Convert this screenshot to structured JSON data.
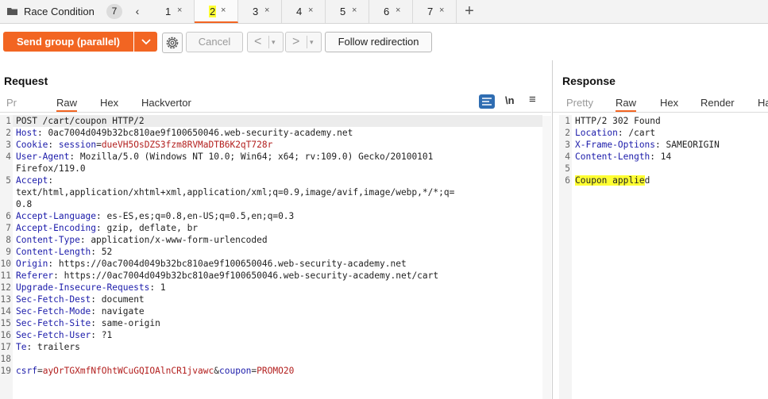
{
  "tab_bar": {
    "group_name": "Race Condition",
    "group_count": "7",
    "collapse_icon": "chevron-left-icon",
    "tabs": [
      {
        "label": "1",
        "close": "×"
      },
      {
        "label": "2",
        "close": "×"
      },
      {
        "label": "3",
        "close": "×"
      },
      {
        "label": "4",
        "close": "×"
      },
      {
        "label": "5",
        "close": "×"
      },
      {
        "label": "6",
        "close": "×"
      },
      {
        "label": "7",
        "close": "×"
      }
    ],
    "active_tab": "2",
    "add_tab_icon": "plus-icon"
  },
  "toolbar": {
    "send_label": "Send group (parallel)",
    "send_dropdown_glyph": "⌄",
    "settings_icon": "gear-icon",
    "cancel_label": "Cancel",
    "prev_glyph": "<",
    "next_glyph": ">",
    "nav_dropdown_glyph": "▾",
    "follow_label": "Follow redirection"
  },
  "request": {
    "title": "Request",
    "tabs": [
      "Pr",
      "Raw",
      "Hex",
      "Hackvertor"
    ],
    "active_tab": "Raw",
    "newline_label": "\\n",
    "menu_glyph": "≡",
    "lines": [
      {
        "n": "1",
        "text": "POST /cart/coupon HTTP/2"
      },
      {
        "n": "2",
        "key": "Host",
        "value": "0ac7004d049b32bc810ae9f100650046.web-security-academy.net"
      },
      {
        "n": "3",
        "key": "Cookie",
        "cookie_name": "session",
        "cookie_value": "dueVH5OsDZS3fzm8RVMaDTB6K2qT728r"
      },
      {
        "n": "4",
        "key": "User-Agent",
        "value": "Mozilla/5.0 (Windows NT 10.0; Win64; x64; rv:109.0) Gecko/20100101",
        "cont": "Firefox/119.0"
      },
      {
        "n": "5",
        "key": "Accept",
        "value": "",
        "cont": "text/html,application/xhtml+xml,application/xml;q=0.9,image/avif,image/webp,*/*;q=",
        "cont2": "0.8"
      },
      {
        "n": "6",
        "key": "Accept-Language",
        "value": "es-ES,es;q=0.8,en-US;q=0.5,en;q=0.3"
      },
      {
        "n": "7",
        "key": "Accept-Encoding",
        "value": "gzip, deflate, br"
      },
      {
        "n": "8",
        "key": "Content-Type",
        "value": "application/x-www-form-urlencoded"
      },
      {
        "n": "9",
        "key": "Content-Length",
        "value": "52"
      },
      {
        "n": "10",
        "key": "Origin",
        "value": "https://0ac7004d049b32bc810ae9f100650046.web-security-academy.net"
      },
      {
        "n": "11",
        "key": "Referer",
        "value": "https://0ac7004d049b32bc810ae9f100650046.web-security-academy.net/cart"
      },
      {
        "n": "12",
        "key": "Upgrade-Insecure-Requests",
        "value": "1"
      },
      {
        "n": "13",
        "key": "Sec-Fetch-Dest",
        "value": "document"
      },
      {
        "n": "14",
        "key": "Sec-Fetch-Mode",
        "value": "navigate"
      },
      {
        "n": "15",
        "key": "Sec-Fetch-Site",
        "value": "same-origin"
      },
      {
        "n": "16",
        "key": "Sec-Fetch-User",
        "value": "?1"
      },
      {
        "n": "17",
        "key": "Te",
        "value": "trailers"
      },
      {
        "n": "18"
      },
      {
        "n": "19",
        "body": {
          "k1": "csrf",
          "v1": "ayOrTGXmfNfOhtWCuGQIOAlnCR1jvawc",
          "k2": "coupon",
          "v2": "PROMO20"
        }
      }
    ]
  },
  "response": {
    "title": "Response",
    "tabs": [
      "Pretty",
      "Raw",
      "Hex",
      "Render",
      "Ha"
    ],
    "active_tab": "Raw",
    "lines": [
      {
        "n": "1",
        "text": "HTTP/2 302 Found"
      },
      {
        "n": "2",
        "key": "Location",
        "value": "/cart"
      },
      {
        "n": "3",
        "key": "X-Frame-Options",
        "value": "SAMEORIGIN"
      },
      {
        "n": "4",
        "key": "Content-Length",
        "value": "14"
      },
      {
        "n": "5"
      },
      {
        "n": "6",
        "text_hl": "Coupon applie",
        "text_rest": "d"
      }
    ]
  },
  "colors": {
    "accent": "#f26522",
    "header_key": "#1b1baa",
    "param": "#b3201f",
    "highlight": "#ffff33"
  }
}
